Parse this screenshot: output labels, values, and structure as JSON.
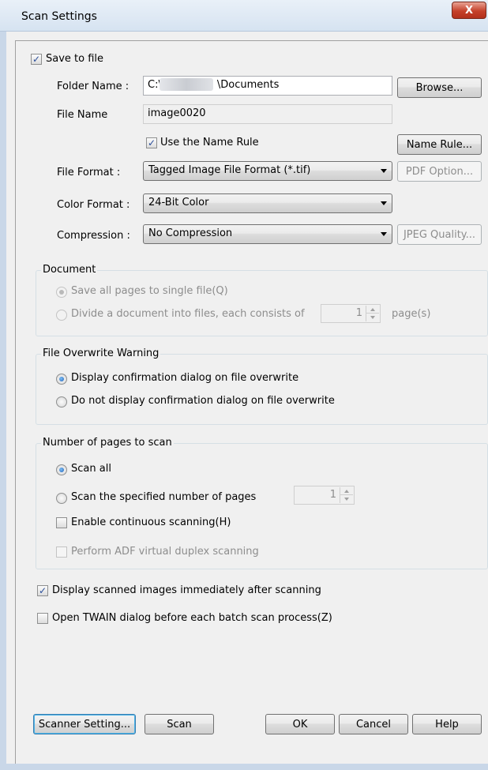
{
  "window": {
    "title": "Scan Settings",
    "close_glyph": "X"
  },
  "save_to_file": {
    "label": "Save to file",
    "checked": true
  },
  "folder": {
    "label": "Folder Name :",
    "value_prefix": "C:\\",
    "value_suffix": "\\Documents",
    "browse": "Browse..."
  },
  "file_name": {
    "label": "File Name",
    "value": "image0020"
  },
  "name_rule": {
    "label": "Use the Name Rule",
    "checked": true,
    "button": "Name Rule..."
  },
  "file_format": {
    "label": "File Format :",
    "value": "Tagged Image File Format (*.tif)",
    "option_button": "PDF Option..."
  },
  "color_format": {
    "label": "Color Format :",
    "value": "24-Bit Color"
  },
  "compression": {
    "label": "Compression :",
    "value": "No Compression",
    "quality_button": "JPEG Quality..."
  },
  "document": {
    "title": "Document",
    "single": "Save all pages to single file(Q)",
    "divide": "Divide a document into files, each consists of",
    "pages_value": "1",
    "pages_unit": "page(s)"
  },
  "overwrite": {
    "title": "File Overwrite Warning",
    "display": "Display confirmation dialog on file overwrite",
    "no_display": "Do not display confirmation dialog on file overwrite"
  },
  "pages": {
    "title": "Number of pages to scan",
    "scan_all": "Scan all",
    "specified": "Scan the specified number of pages",
    "specified_value": "1",
    "continuous": "Enable continuous scanning(H)",
    "adf": "Perform ADF virtual duplex scanning"
  },
  "display_images": {
    "label": "Display scanned images immediately after scanning",
    "checked": true
  },
  "open_twain": {
    "label": "Open TWAIN dialog before each batch scan process(Z)",
    "checked": false
  },
  "buttons": {
    "scanner_setting": "Scanner Setting...",
    "scan": "Scan",
    "ok": "OK",
    "cancel": "Cancel",
    "help": "Help"
  },
  "check_glyph": "✓"
}
